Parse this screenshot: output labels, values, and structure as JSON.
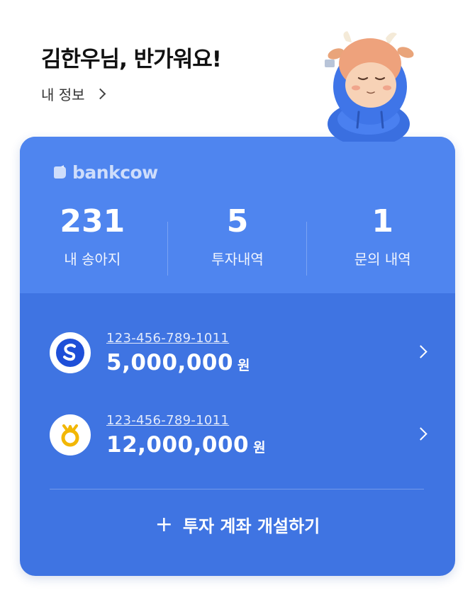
{
  "header": {
    "greeting": "김한우님, 반가워요!",
    "my_info_label": "내 정보"
  },
  "brand": {
    "name": "bankcow"
  },
  "stats": [
    {
      "value": "231",
      "label": "내 송아지"
    },
    {
      "value": "5",
      "label": "투자내역"
    },
    {
      "value": "1",
      "label": "문의 내역"
    }
  ],
  "accounts": [
    {
      "number": "123-456-789-1011",
      "amount": "5,000,000",
      "unit": "원",
      "bank_icon": "shinhan-bank-icon"
    },
    {
      "number": "123-456-789-1011",
      "amount": "12,000,000",
      "unit": "원",
      "bank_icon": "kb-bank-icon"
    }
  ],
  "open_account_label": "투자 계좌 개설하기",
  "colors": {
    "card_top": "#4f85ef",
    "card_bottom": "#3f74e2",
    "kb_gold": "#f2b705",
    "shinhan_blue": "#1e4fd8"
  }
}
